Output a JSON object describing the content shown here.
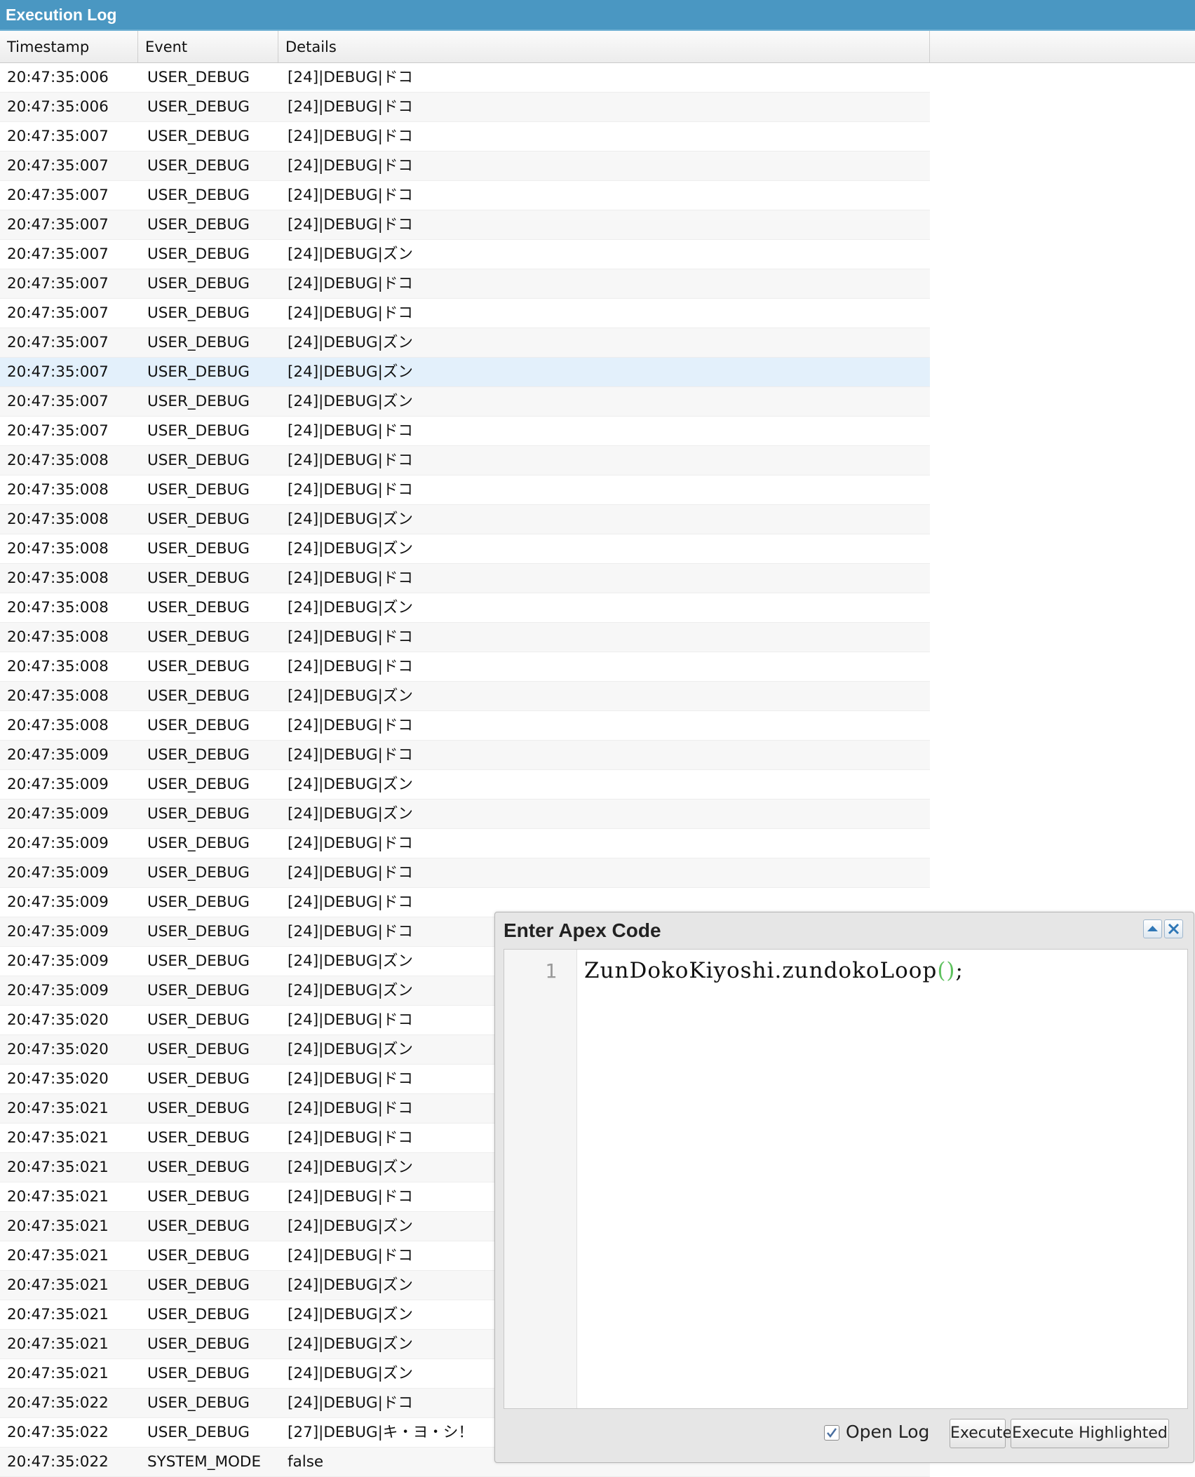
{
  "panel": {
    "title": "Execution Log"
  },
  "columns": {
    "timestamp": "Timestamp",
    "event": "Event",
    "details": "Details"
  },
  "rows": [
    {
      "timestamp": "20:47:35:006",
      "event": "USER_DEBUG",
      "details": "[24]|DEBUG|ドコ"
    },
    {
      "timestamp": "20:47:35:006",
      "event": "USER_DEBUG",
      "details": "[24]|DEBUG|ドコ"
    },
    {
      "timestamp": "20:47:35:007",
      "event": "USER_DEBUG",
      "details": "[24]|DEBUG|ドコ"
    },
    {
      "timestamp": "20:47:35:007",
      "event": "USER_DEBUG",
      "details": "[24]|DEBUG|ドコ"
    },
    {
      "timestamp": "20:47:35:007",
      "event": "USER_DEBUG",
      "details": "[24]|DEBUG|ドコ"
    },
    {
      "timestamp": "20:47:35:007",
      "event": "USER_DEBUG",
      "details": "[24]|DEBUG|ドコ"
    },
    {
      "timestamp": "20:47:35:007",
      "event": "USER_DEBUG",
      "details": "[24]|DEBUG|ズン"
    },
    {
      "timestamp": "20:47:35:007",
      "event": "USER_DEBUG",
      "details": "[24]|DEBUG|ドコ"
    },
    {
      "timestamp": "20:47:35:007",
      "event": "USER_DEBUG",
      "details": "[24]|DEBUG|ドコ"
    },
    {
      "timestamp": "20:47:35:007",
      "event": "USER_DEBUG",
      "details": "[24]|DEBUG|ズン"
    },
    {
      "timestamp": "20:47:35:007",
      "event": "USER_DEBUG",
      "details": "[24]|DEBUG|ズン"
    },
    {
      "timestamp": "20:47:35:007",
      "event": "USER_DEBUG",
      "details": "[24]|DEBUG|ズン"
    },
    {
      "timestamp": "20:47:35:007",
      "event": "USER_DEBUG",
      "details": "[24]|DEBUG|ドコ"
    },
    {
      "timestamp": "20:47:35:008",
      "event": "USER_DEBUG",
      "details": "[24]|DEBUG|ドコ"
    },
    {
      "timestamp": "20:47:35:008",
      "event": "USER_DEBUG",
      "details": "[24]|DEBUG|ドコ"
    },
    {
      "timestamp": "20:47:35:008",
      "event": "USER_DEBUG",
      "details": "[24]|DEBUG|ズン"
    },
    {
      "timestamp": "20:47:35:008",
      "event": "USER_DEBUG",
      "details": "[24]|DEBUG|ズン"
    },
    {
      "timestamp": "20:47:35:008",
      "event": "USER_DEBUG",
      "details": "[24]|DEBUG|ドコ"
    },
    {
      "timestamp": "20:47:35:008",
      "event": "USER_DEBUG",
      "details": "[24]|DEBUG|ズン"
    },
    {
      "timestamp": "20:47:35:008",
      "event": "USER_DEBUG",
      "details": "[24]|DEBUG|ドコ"
    },
    {
      "timestamp": "20:47:35:008",
      "event": "USER_DEBUG",
      "details": "[24]|DEBUG|ドコ"
    },
    {
      "timestamp": "20:47:35:008",
      "event": "USER_DEBUG",
      "details": "[24]|DEBUG|ズン"
    },
    {
      "timestamp": "20:47:35:008",
      "event": "USER_DEBUG",
      "details": "[24]|DEBUG|ドコ"
    },
    {
      "timestamp": "20:47:35:009",
      "event": "USER_DEBUG",
      "details": "[24]|DEBUG|ドコ"
    },
    {
      "timestamp": "20:47:35:009",
      "event": "USER_DEBUG",
      "details": "[24]|DEBUG|ズン"
    },
    {
      "timestamp": "20:47:35:009",
      "event": "USER_DEBUG",
      "details": "[24]|DEBUG|ズン"
    },
    {
      "timestamp": "20:47:35:009",
      "event": "USER_DEBUG",
      "details": "[24]|DEBUG|ドコ"
    },
    {
      "timestamp": "20:47:35:009",
      "event": "USER_DEBUG",
      "details": "[24]|DEBUG|ドコ"
    },
    {
      "timestamp": "20:47:35:009",
      "event": "USER_DEBUG",
      "details": "[24]|DEBUG|ドコ"
    },
    {
      "timestamp": "20:47:35:009",
      "event": "USER_DEBUG",
      "details": "[24]|DEBUG|ドコ"
    },
    {
      "timestamp": "20:47:35:009",
      "event": "USER_DEBUG",
      "details": "[24]|DEBUG|ズン"
    },
    {
      "timestamp": "20:47:35:009",
      "event": "USER_DEBUG",
      "details": "[24]|DEBUG|ズン"
    },
    {
      "timestamp": "20:47:35:020",
      "event": "USER_DEBUG",
      "details": "[24]|DEBUG|ドコ"
    },
    {
      "timestamp": "20:47:35:020",
      "event": "USER_DEBUG",
      "details": "[24]|DEBUG|ズン"
    },
    {
      "timestamp": "20:47:35:020",
      "event": "USER_DEBUG",
      "details": "[24]|DEBUG|ドコ"
    },
    {
      "timestamp": "20:47:35:021",
      "event": "USER_DEBUG",
      "details": "[24]|DEBUG|ドコ"
    },
    {
      "timestamp": "20:47:35:021",
      "event": "USER_DEBUG",
      "details": "[24]|DEBUG|ドコ"
    },
    {
      "timestamp": "20:47:35:021",
      "event": "USER_DEBUG",
      "details": "[24]|DEBUG|ズン"
    },
    {
      "timestamp": "20:47:35:021",
      "event": "USER_DEBUG",
      "details": "[24]|DEBUG|ドコ"
    },
    {
      "timestamp": "20:47:35:021",
      "event": "USER_DEBUG",
      "details": "[24]|DEBUG|ズン"
    },
    {
      "timestamp": "20:47:35:021",
      "event": "USER_DEBUG",
      "details": "[24]|DEBUG|ドコ"
    },
    {
      "timestamp": "20:47:35:021",
      "event": "USER_DEBUG",
      "details": "[24]|DEBUG|ズン"
    },
    {
      "timestamp": "20:47:35:021",
      "event": "USER_DEBUG",
      "details": "[24]|DEBUG|ズン"
    },
    {
      "timestamp": "20:47:35:021",
      "event": "USER_DEBUG",
      "details": "[24]|DEBUG|ズン"
    },
    {
      "timestamp": "20:47:35:021",
      "event": "USER_DEBUG",
      "details": "[24]|DEBUG|ズン"
    },
    {
      "timestamp": "20:47:35:022",
      "event": "USER_DEBUG",
      "details": "[24]|DEBUG|ドコ"
    },
    {
      "timestamp": "20:47:35:022",
      "event": "USER_DEBUG",
      "details": "[27]|DEBUG|キ・ヨ・シ！"
    },
    {
      "timestamp": "20:47:35:022",
      "event": "SYSTEM_MODE",
      "details": "false"
    }
  ],
  "selected_row": 10,
  "dialog": {
    "title": "Enter Apex Code",
    "line_number": "1",
    "code_name": "ZunDokoKiyoshi.zundokoLoop",
    "code_parens": "()",
    "code_end": ";",
    "open_log_label": "Open Log",
    "open_log_checked": true,
    "execute_label": "Execute",
    "execute_highlighted_label": "Execute Highlighted",
    "paren_color": "#5ec15e"
  },
  "colors": {
    "titlebar": "#4a97c2",
    "selected_row": "#e3f0fb"
  }
}
